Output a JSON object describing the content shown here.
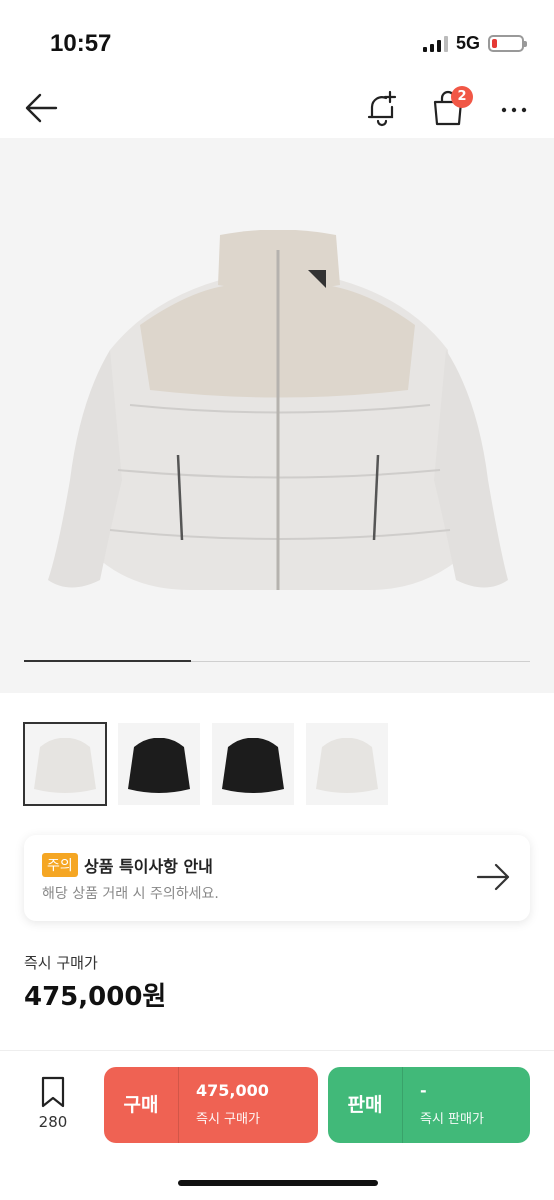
{
  "status_bar": {
    "time": "10:57",
    "network": "5G"
  },
  "nav": {
    "cart_badge": "2"
  },
  "gallery": {
    "progress": 0.33,
    "thumbnail_colors": [
      "#e6e4e1",
      "#1c1c1c",
      "#1c1c1c",
      "#e6e4e1"
    ]
  },
  "notice": {
    "tag": "주의",
    "title": "상품 특이사항 안내",
    "subtitle": "해당 상품 거래 시 주의하세요."
  },
  "price": {
    "label": "즉시 구매가",
    "value": "475,000원"
  },
  "bottom_bar": {
    "bookmark_count": "280",
    "buy": {
      "label": "구매",
      "price": "475,000",
      "sub": "즉시 구매가"
    },
    "sell": {
      "label": "판매",
      "price": "-",
      "sub": "즉시 판매가"
    }
  },
  "colors": {
    "buy": "#ef6253",
    "sell": "#41b979",
    "badge": "#f15746",
    "notice_tag": "#f5a623"
  }
}
